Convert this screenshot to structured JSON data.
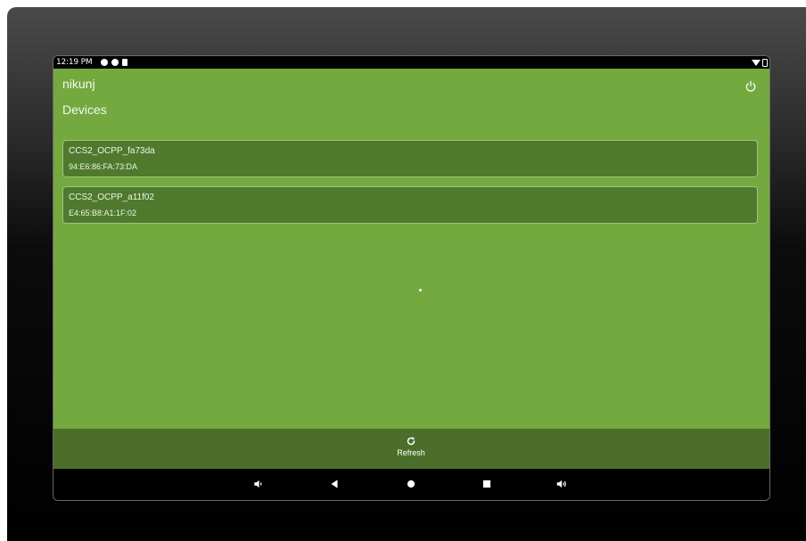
{
  "status_bar": {
    "time": "12:19 PM"
  },
  "header": {
    "username": "nikunj",
    "power_icon": "power-icon"
  },
  "devices": {
    "title": "Devices",
    "items": [
      {
        "name": "CCS2_OCPP_fa73da",
        "mac": "94:E6:86:FA:73:DA"
      },
      {
        "name": "CCS2_OCPP_a11f02",
        "mac": "E4:65:B8:A1:1F:02"
      }
    ]
  },
  "footer": {
    "refresh_label": "Refresh",
    "refresh_icon": "refresh-icon"
  },
  "nav_bar": {
    "icons": [
      "volume-down-icon",
      "back-icon",
      "home-icon",
      "recents-icon",
      "volume-up-icon"
    ]
  },
  "colors": {
    "app_background": "#73a93f",
    "card_background": "#4f7a2e",
    "bottom_bar": "#4b6e2a"
  }
}
